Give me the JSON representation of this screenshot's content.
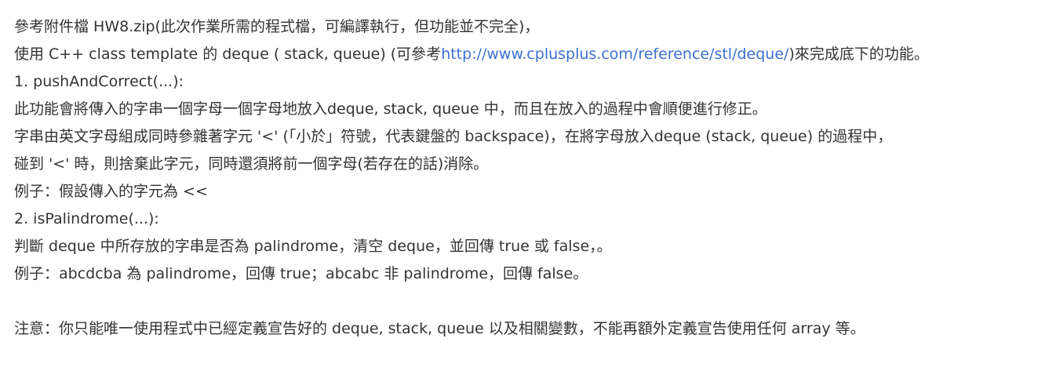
{
  "document": {
    "lines": {
      "l1": "參考附件檔 HW8.zip(此次作業所需的程式檔，可編譯執行，但功能並不完全)，",
      "l2": {
        "before": "使用 C++ class template 的 deque ( stack, queue) (可參考",
        "link": "http://www.cplusplus.com/reference/stl/deque/",
        "after": ")來完成底下的功能。"
      },
      "l3": "1. pushAndCorrect(...):",
      "l4": "此功能會將傳入的字串一個字母一個字母地放入deque, stack, queue 中，而且在放入的過程中會順便進行修正。",
      "l5": "字串由英文字母組成同時參雜著字元 '<' (「小於」符號，代表鍵盤的 backspace)，在將字母放入deque (stack, queue) 的過程中，",
      "l6": "碰到 '<' 時，則捨棄此字元，同時還須將前一個字母(若存在的話)消除。",
      "l7": "例子：假設傳入的字元為 <<",
      "l8": "2. isPalindrome(...):",
      "l9": "判斷 deque 中所存放的字串是否為 palindrome，清空 deque，並回傳 true 或 false，。",
      "l10": "例子：abcdcba 為 palindrome，回傳 true；abcabc 非 palindrome，回傳 false。",
      "l12": "注意：你只能唯一使用程式中已經定義宣告好的 deque, stack, queue 以及相關變數，不能再額外定義宣告使用任何 array 等。"
    }
  },
  "colors": {
    "text": "#333333",
    "link": "#3c6fd1",
    "background": "#ffffff"
  }
}
